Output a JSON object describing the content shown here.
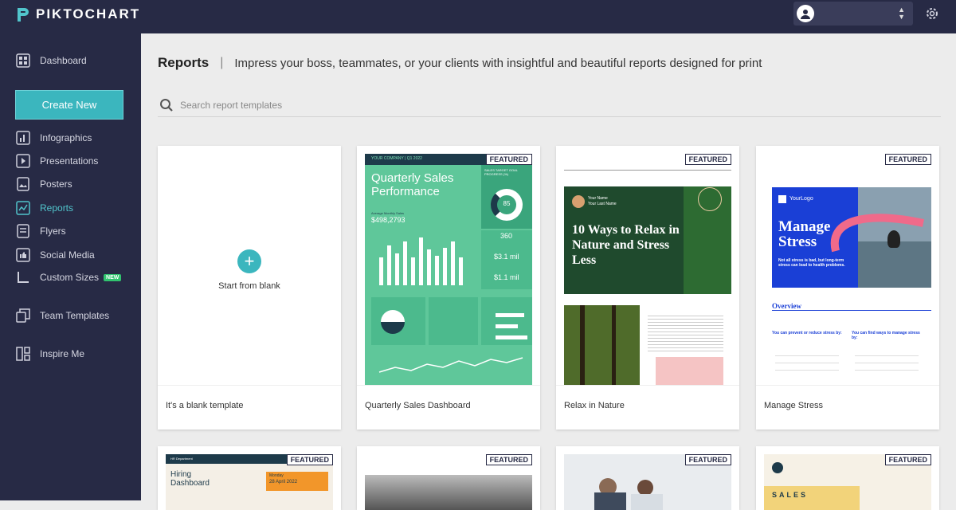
{
  "brand": {
    "name": "PIKTOCHART",
    "accent": "#3bb6be",
    "nav_bg": "#272a45"
  },
  "sidebar": {
    "dashboard": "Dashboard",
    "create_new": "Create New",
    "items": [
      {
        "label": "Infographics",
        "icon": "bar-chart-icon"
      },
      {
        "label": "Presentations",
        "icon": "presentation-icon"
      },
      {
        "label": "Posters",
        "icon": "poster-icon"
      },
      {
        "label": "Reports",
        "icon": "report-icon",
        "active": true
      },
      {
        "label": "Flyers",
        "icon": "flyer-icon"
      },
      {
        "label": "Social Media",
        "icon": "social-media-icon"
      },
      {
        "label": "Custom Sizes",
        "icon": "custom-size-icon",
        "badge": "NEW"
      }
    ],
    "team_templates": "Team Templates",
    "inspire_me": "Inspire Me"
  },
  "main": {
    "title": "Reports",
    "separator": "|",
    "subtitle": "Impress your boss, teammates, or your clients with insightful and beautiful reports designed for print",
    "search_placeholder": "Search report templates",
    "featured_label": "FEATURED",
    "blank": {
      "action": "Start from blank",
      "caption": "It's a blank template"
    },
    "cards": [
      {
        "caption": "Quarterly Sales Dashboard",
        "company": "YOUR COMPANY | Q1 2022",
        "headline": "Quarterly Sales Performance",
        "goal_label": "SALES TARGET GOAL PROGRESS (%)",
        "goal_value": "85",
        "avg_label": "Average Monthly Sales",
        "avg_value": "$498,2793",
        "stat1": "360",
        "stat2": "$3.1 mil",
        "stat3": "$1.1 mil"
      },
      {
        "caption": "Relax in Nature",
        "headline": "10 Ways to Relax in Nature and Stress Less",
        "author1": "Your Name",
        "author2": "Your Last Name"
      },
      {
        "caption": "Manage Stress",
        "logo": "YourLogo",
        "headline": "Manage Stress",
        "body": "Not all stress is bad, but long-term stress can lead to health problems.",
        "overview": "Overview",
        "col1": "You can prevent or reduce stress by:",
        "col2": "You can find ways to manage stress by:"
      }
    ],
    "row2": [
      {
        "headline": "Hiring Dashboard",
        "date_day": "Monday",
        "date": "28 April 2022",
        "dept": "HR Department"
      },
      {
        "headline": ""
      },
      {
        "headline": ""
      },
      {
        "headline": "SALES"
      }
    ]
  }
}
